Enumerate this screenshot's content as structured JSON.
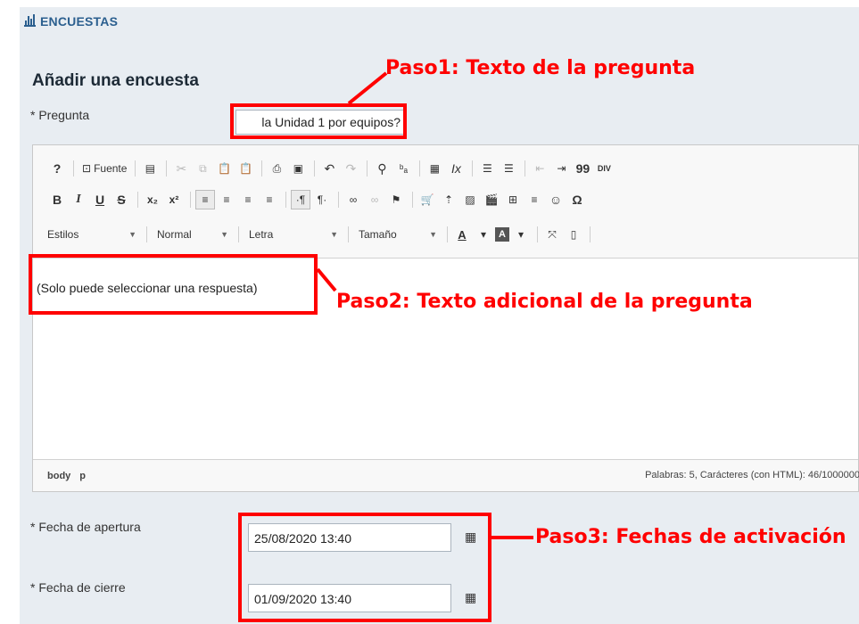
{
  "header": {
    "section_title": "ENCUESTAS",
    "icon": "bar-chart-icon"
  },
  "form": {
    "title": "Añadir una encuesta",
    "question_label": "* Pregunta",
    "question_value": "la Unidad 1 por equipos?",
    "editor_content": "(Solo puede seleccionar una respuesta)",
    "open_date_label": "* Fecha de apertura",
    "open_date_value": "25/08/2020 13:40",
    "close_date_label": "* Fecha de cierre",
    "close_date_value": "01/09/2020 13:40",
    "calendar_icon": "calendar-icon"
  },
  "editor": {
    "toolbar": {
      "help": "?",
      "source": "Fuente",
      "bold": "B",
      "italic": "I",
      "underline": "U",
      "strike": "S",
      "subscript": "x₂",
      "superscript": "x²",
      "blockquote": "99",
      "special_char": "Ω",
      "div": "DIV",
      "styles": "Estilos",
      "format": "Normal",
      "font": "Letra",
      "size": "Tamaño",
      "text_color": "A",
      "bg_color": "A"
    },
    "status_path": [
      "body",
      "p"
    ],
    "word_count": "Palabras: 5, Carácteres (con HTML): 46/1000000"
  },
  "annotations": {
    "step1": "Paso1: Texto de la pregunta",
    "step2": "Paso2: Texto adicional de la pregunta",
    "step3": "Paso3: Fechas de activación"
  },
  "colors": {
    "annotation": "#ff0000",
    "title_blue": "#2b5f8f",
    "panel_bg": "#e8edf2"
  }
}
